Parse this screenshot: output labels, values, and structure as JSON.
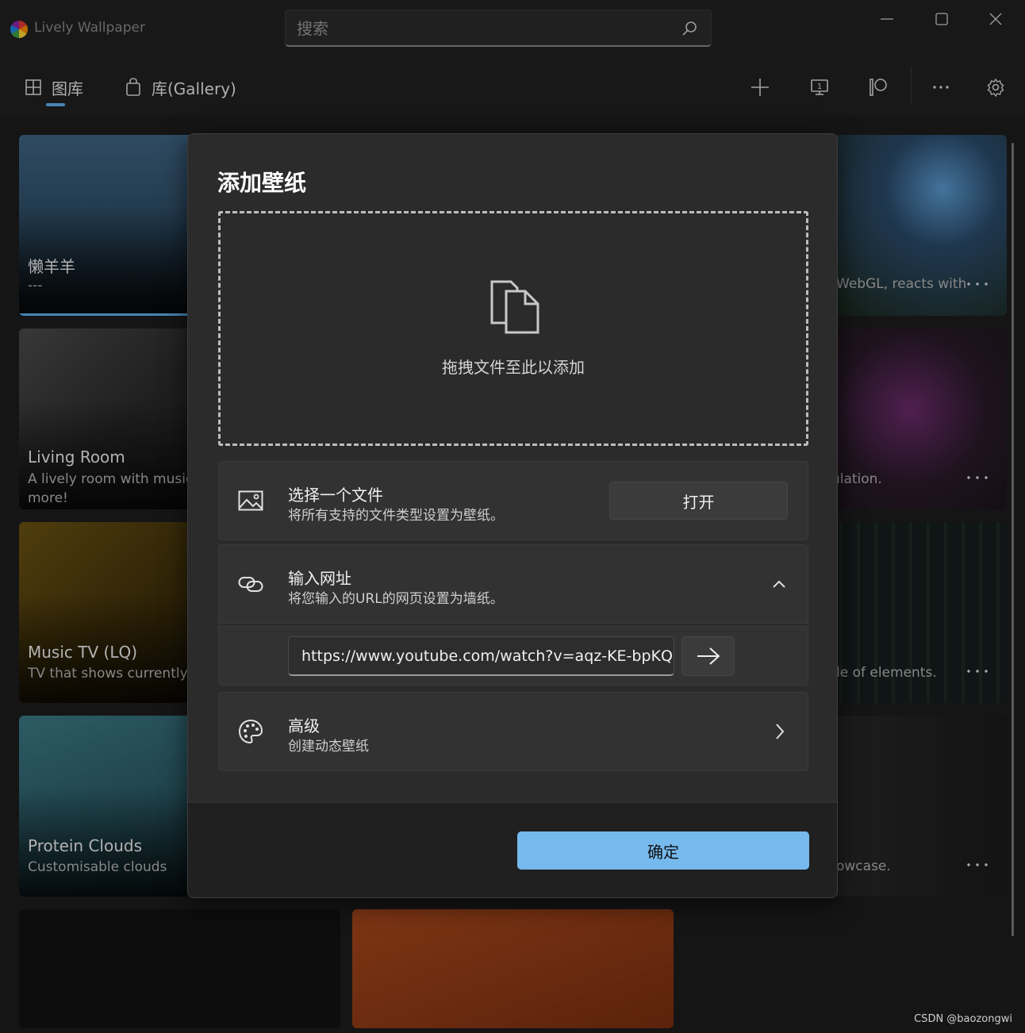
{
  "app": {
    "title": "Lively Wallpaper"
  },
  "search": {
    "placeholder": "搜索"
  },
  "nav": {
    "tabs": [
      {
        "label": "图库",
        "icon": "grid-icon",
        "selected": true
      },
      {
        "label": "库(Gallery)",
        "icon": "shopping-bag-icon",
        "selected": false
      }
    ],
    "tools": [
      "add-icon",
      "monitor-icon",
      "patreon-icon",
      "more-icon",
      "gear-icon"
    ],
    "accent": "#5fb2f2"
  },
  "gallery": {
    "cards": [
      {
        "title": "懒羊羊",
        "desc": "---"
      },
      {
        "title": "Living Room",
        "desc": "A lively room with music,",
        "desc2": "more!"
      },
      {
        "title": "Music TV (LQ)",
        "desc": "TV that shows currently p"
      },
      {
        "title": "Protein Clouds",
        "desc": "Customisable clouds"
      }
    ],
    "right_cards": [
      {
        "desc": "WebGL, reacts with"
      },
      {
        "desc": "ılation."
      },
      {
        "desc": "le of elements."
      },
      {
        "desc": "owcase."
      }
    ]
  },
  "dialog": {
    "title": "添加壁纸",
    "dropzone_text": "拖拽文件至此以添加",
    "file_row": {
      "title": "选择一个文件",
      "subtitle": "将所有支持的文件类型设置为壁纸。",
      "button": "打开"
    },
    "url_row": {
      "title": "输入网址",
      "subtitle": "将您输入的URL的网页设置为墙纸。",
      "value": "https://www.youtube.com/watch?v=aqz-KE-bpKQ"
    },
    "advanced_row": {
      "title": "高级",
      "subtitle": "创建动态壁纸"
    },
    "ok_button": "确定",
    "ok_color": "#76b9ed"
  },
  "watermark": "CSDN @baozongwi"
}
